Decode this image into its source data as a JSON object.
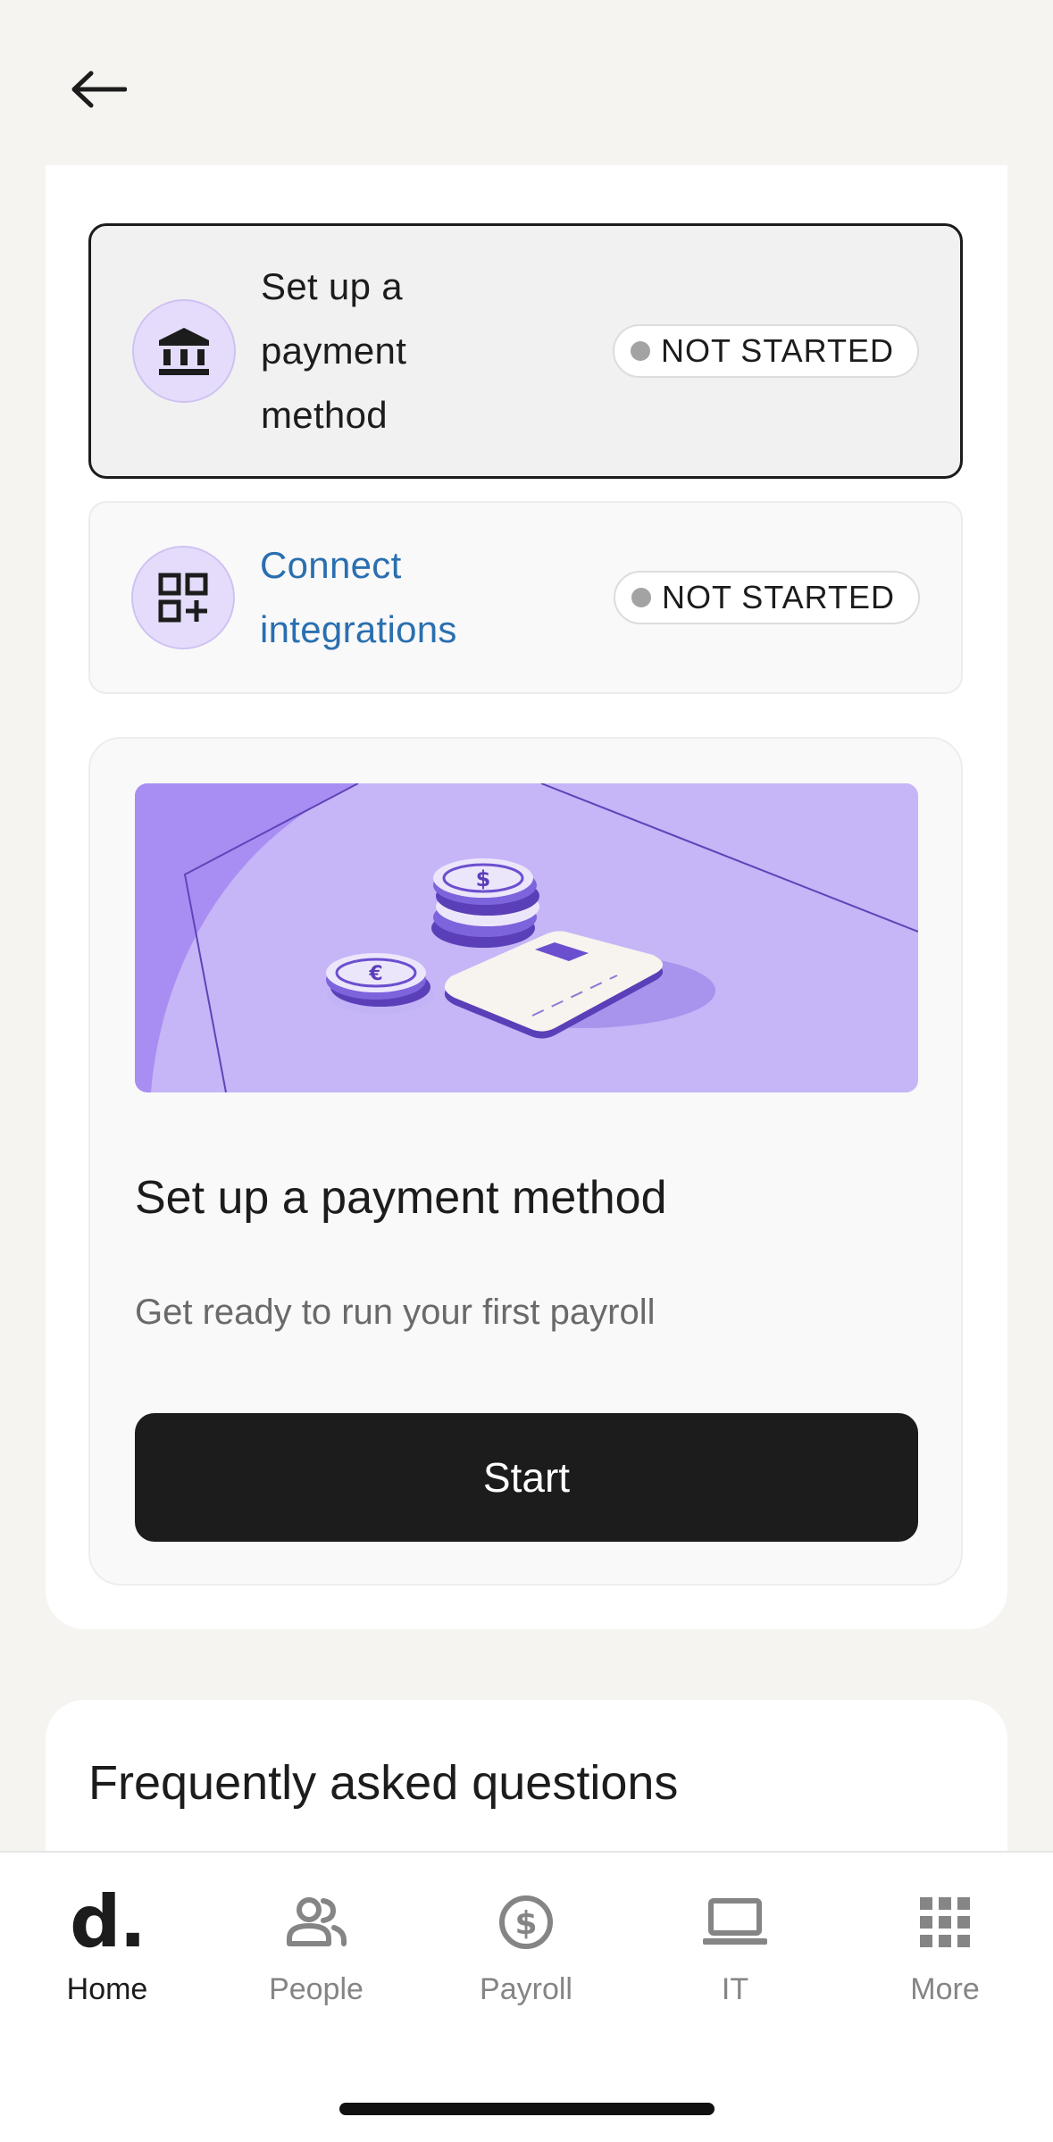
{
  "navigation": {
    "back_icon": "arrow-left-icon"
  },
  "checklist": {
    "colors": {
      "accent_circle": "#e5dcfb",
      "link": "#2a6fb0",
      "badge_dot": "#a3a3a3"
    },
    "tasks": [
      {
        "label": "Set up a payment method",
        "icon": "bank-icon",
        "status": "NOT STARTED",
        "selected": true
      },
      {
        "label": "Connect integrations",
        "icon": "apps-add-icon",
        "status": "NOT STARTED",
        "selected": false
      }
    ]
  },
  "feature": {
    "illustration": "coins-and-card-illustration",
    "title": "Set up a payment method",
    "subtitle": "Get ready to run your first payroll",
    "button_label": "Start"
  },
  "faq": {
    "title": "Frequently asked questions"
  },
  "tab_bar": {
    "items": [
      {
        "label": "Home",
        "icon": "deel-logo-icon",
        "logo_text": "d.",
        "current": true
      },
      {
        "label": "People",
        "icon": "people-icon",
        "current": false
      },
      {
        "label": "Payroll",
        "icon": "dollar-circle-icon",
        "current": false
      },
      {
        "label": "IT",
        "icon": "laptop-icon",
        "current": false
      },
      {
        "label": "More",
        "icon": "grid-icon",
        "current": false
      }
    ]
  }
}
